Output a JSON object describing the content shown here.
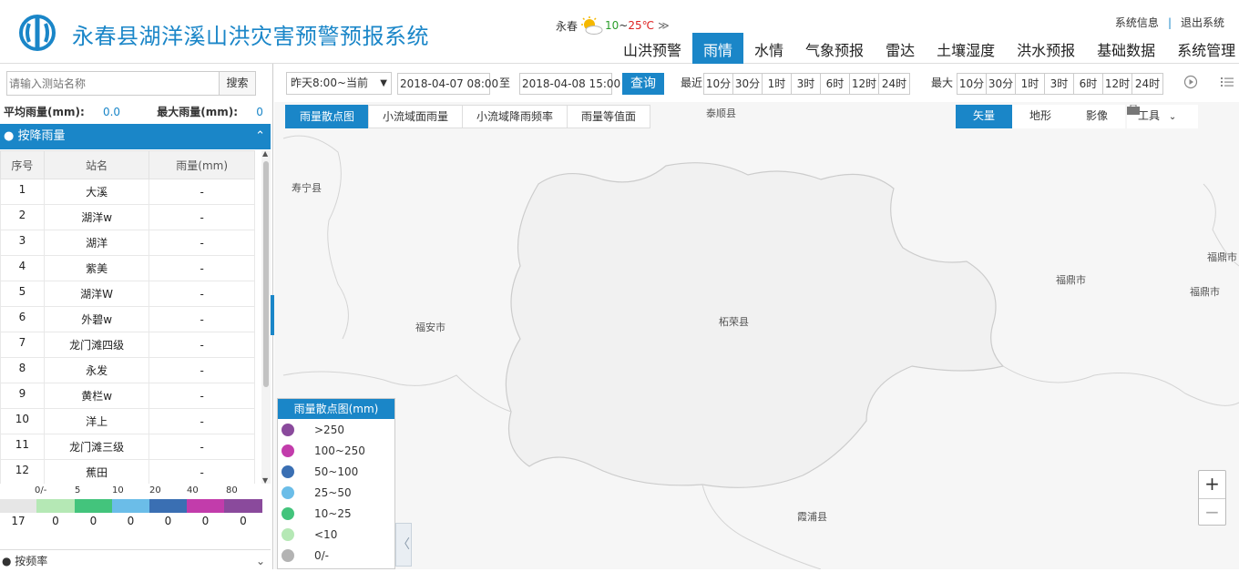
{
  "header": {
    "title": "永春县湖洋溪山洪灾害预警预报系统",
    "weather": {
      "city": "永春",
      "low": "10",
      "sep": "~",
      "high": "25℃",
      "more": "≫"
    },
    "sys_info": "系统信息",
    "sys_sep": "|",
    "logout": "退出系统",
    "nav": [
      "山洪预警",
      "雨情",
      "水情",
      "气象预报",
      "雷达",
      "土壤湿度",
      "洪水预报",
      "基础数据",
      "系统管理"
    ],
    "nav_active": 1
  },
  "left": {
    "search_placeholder": "请输入测站名称",
    "search_btn": "搜索",
    "avg_label": "平均雨量(mm):",
    "avg_value": "0.0",
    "max_label": "最大雨量(mm):",
    "max_value": "0",
    "section_title": "● 按降雨量",
    "section_chev": "⌃",
    "table_headers": [
      "序号",
      "站名",
      "雨量(mm)"
    ],
    "rows": [
      {
        "idx": "1",
        "name": "大溪",
        "rain": "-"
      },
      {
        "idx": "2",
        "name": "湖洋w",
        "rain": "-"
      },
      {
        "idx": "3",
        "name": "湖洋",
        "rain": "-"
      },
      {
        "idx": "4",
        "name": "紫美",
        "rain": "-"
      },
      {
        "idx": "5",
        "name": "湖洋W",
        "rain": "-"
      },
      {
        "idx": "6",
        "name": "外碧w",
        "rain": "-"
      },
      {
        "idx": "7",
        "name": "龙门滩四级",
        "rain": "-"
      },
      {
        "idx": "8",
        "name": "永发",
        "rain": "-"
      },
      {
        "idx": "9",
        "name": "黄栏w",
        "rain": "-"
      },
      {
        "idx": "10",
        "name": "洋上",
        "rain": "-"
      },
      {
        "idx": "11",
        "name": "龙门滩三级",
        "rain": "-"
      },
      {
        "idx": "12",
        "name": "蕉田",
        "rain": "-"
      }
    ],
    "strip_labels": [
      "0/-",
      "5",
      "10",
      "20",
      "40",
      "80"
    ],
    "strip_colors": [
      "#e6e6e6",
      "#b5e8b5",
      "#43c47c",
      "#6bbde8",
      "#3a6fb3",
      "#c23cab",
      "#8a4a9c"
    ],
    "strip_counts": [
      "17",
      "0",
      "0",
      "0",
      "0",
      "0",
      "0"
    ],
    "sub_section": "● 按频率",
    "sub_chev": "⌄"
  },
  "toolbar": {
    "range_select": "昨天8:00~当前",
    "date_from": "2018-04-07 08:00",
    "to_label": "至",
    "date_to": "2018-04-08 15:00",
    "query_btn": "查询",
    "recent_label": "最近",
    "recent_btns": [
      "10分",
      "30分",
      "1时",
      "3时",
      "6时",
      "12时",
      "24时"
    ],
    "max_label": "最大",
    "max_btns": [
      "10分",
      "30分",
      "1时",
      "3时",
      "6时",
      "12时",
      "24时"
    ]
  },
  "map": {
    "tabs": [
      "雨量散点图",
      "小流域面雨量",
      "小流域降雨频率",
      "雨量等值面"
    ],
    "active_tab": 0,
    "layers": [
      "矢量",
      "地形",
      "影像"
    ],
    "active_layer": 0,
    "tools_label": "工具",
    "places": [
      "泰顺县",
      "寿宁县",
      "福安市",
      "柘荣县",
      "福鼎市",
      "福鼎市",
      "福鼎市",
      "霞浦县"
    ],
    "legend_title": "雨量散点图(mm)",
    "legend": [
      {
        "label": ">250",
        "color": "#8a4a9c"
      },
      {
        "label": "100~250",
        "color": "#c23cab"
      },
      {
        "label": "50~100",
        "color": "#3a6fb3"
      },
      {
        "label": "25~50",
        "color": "#6bbde8"
      },
      {
        "label": "10~25",
        "color": "#43c47c"
      },
      {
        "label": "<10",
        "color": "#b5e8b5"
      },
      {
        "label": "0/-",
        "color": "#b3b3b3"
      }
    ],
    "zoom_in": "+",
    "zoom_out": "−",
    "collapse": "〈"
  }
}
